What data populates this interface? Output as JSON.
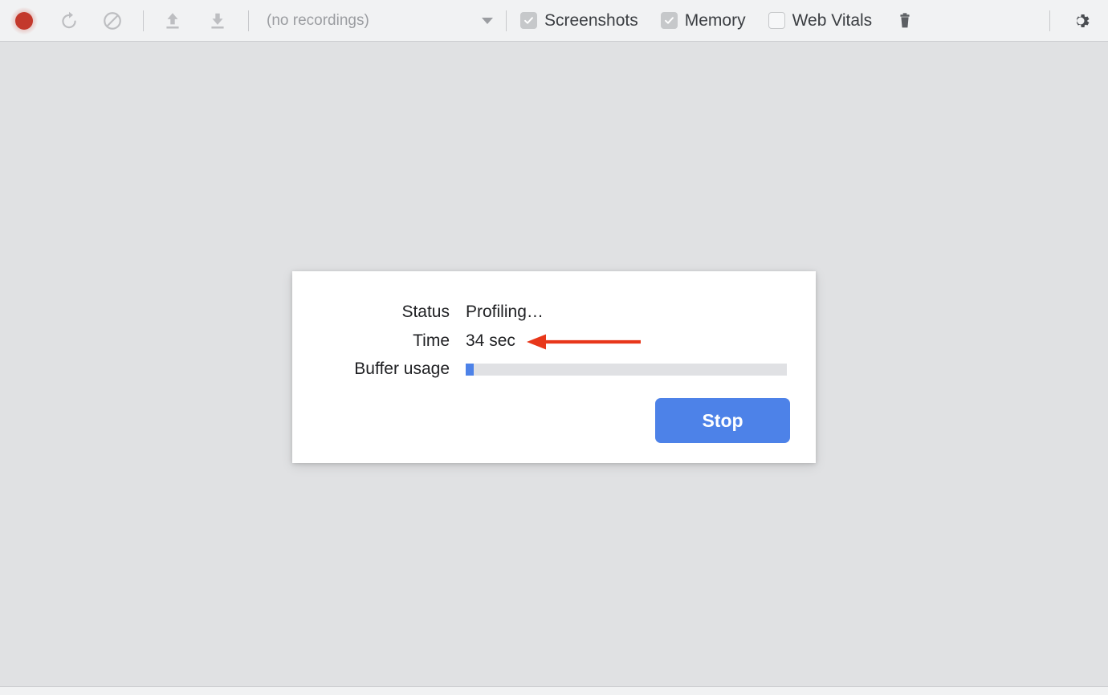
{
  "toolbar": {
    "record_button": "record-dot",
    "reload_button": "reload-icon",
    "clear_button": "clear-icon",
    "upload_button": "upload-icon",
    "download_button": "download-icon",
    "recordings_select": {
      "value": "(no recordings)",
      "caret": "chevron-down-icon"
    },
    "checkboxes": [
      {
        "label": "Screenshots",
        "checked": true,
        "disabled": true
      },
      {
        "label": "Memory",
        "checked": true,
        "disabled": true
      },
      {
        "label": "Web Vitals",
        "checked": false,
        "disabled": false
      }
    ],
    "trash_button": "trash-icon",
    "settings_button": "gear-icon"
  },
  "dialog": {
    "rows": [
      {
        "label": "Status",
        "value": "Profiling…"
      },
      {
        "label": "Time",
        "value": "34 sec"
      },
      {
        "label": "Buffer usage",
        "value": ""
      }
    ],
    "buffer_usage_percent": 2.5,
    "stop_label": "Stop"
  },
  "colors": {
    "record_red": "#c3392c",
    "accent_blue": "#4d82e8",
    "annotation_red": "#e8371a",
    "toolbar_bg": "#f1f2f3",
    "page_bg": "#e0e1e3",
    "dialog_bg": "#ffffff",
    "progress_track": "#e0e1e4",
    "text_primary": "#202124",
    "icon_disabled": "#bdbec1",
    "icon_active": "#5c5f63"
  },
  "annotation": {
    "type": "arrow",
    "direction": "left",
    "color": "#e8371a"
  }
}
